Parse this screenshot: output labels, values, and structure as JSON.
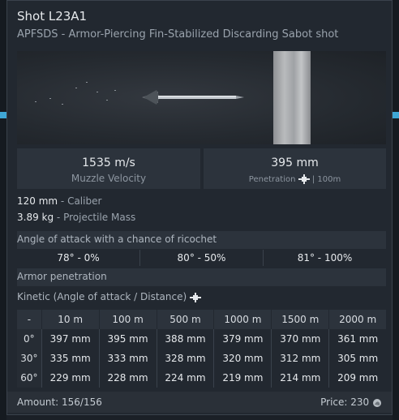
{
  "shell": {
    "title": "Shot L23A1",
    "subtitle": "APFSDS - Armor-Piercing Fin-Stabilized Discarding Sabot shot"
  },
  "stats": {
    "muzzle_velocity_value": "1535 m/s",
    "muzzle_velocity_label": "Muzzle Velocity",
    "penetration_value": "395 mm",
    "penetration_label": "Penetration",
    "penetration_distance": "| 100m"
  },
  "specs": {
    "caliber_value": "120 mm",
    "caliber_label": " - Caliber",
    "mass_value": "3.89 kg",
    "mass_label": " - Projectile Mass"
  },
  "ricochet": {
    "header": "Angle of attack with a chance of ricochet",
    "cells": [
      "78° - 0%",
      "80° - 50%",
      "81° - 100%"
    ]
  },
  "armor": {
    "header": "Armor penetration",
    "kinetic_label": "Kinetic (Angle of attack / Distance)",
    "columns": [
      "-",
      "10 m",
      "100 m",
      "500 m",
      "1000 m",
      "1500 m",
      "2000 m"
    ],
    "rows": [
      {
        "angle": "0°",
        "values": [
          "397 mm",
          "395 mm",
          "388 mm",
          "379 mm",
          "370 mm",
          "361 mm"
        ]
      },
      {
        "angle": "30°",
        "values": [
          "335 mm",
          "333 mm",
          "328 mm",
          "320 mm",
          "312 mm",
          "305 mm"
        ]
      },
      {
        "angle": "60°",
        "values": [
          "229 mm",
          "228 mm",
          "224 mm",
          "219 mm",
          "214 mm",
          "209 mm"
        ]
      }
    ]
  },
  "footer": {
    "amount": "Amount: 156/156",
    "price": "Price: 230"
  },
  "icons": {
    "crosshair": "crosshair-icon",
    "currency": "silver-lion-icon"
  },
  "colors": {
    "accent": "#3fa7d6",
    "panel": "#222830",
    "header": "#2c333c"
  }
}
